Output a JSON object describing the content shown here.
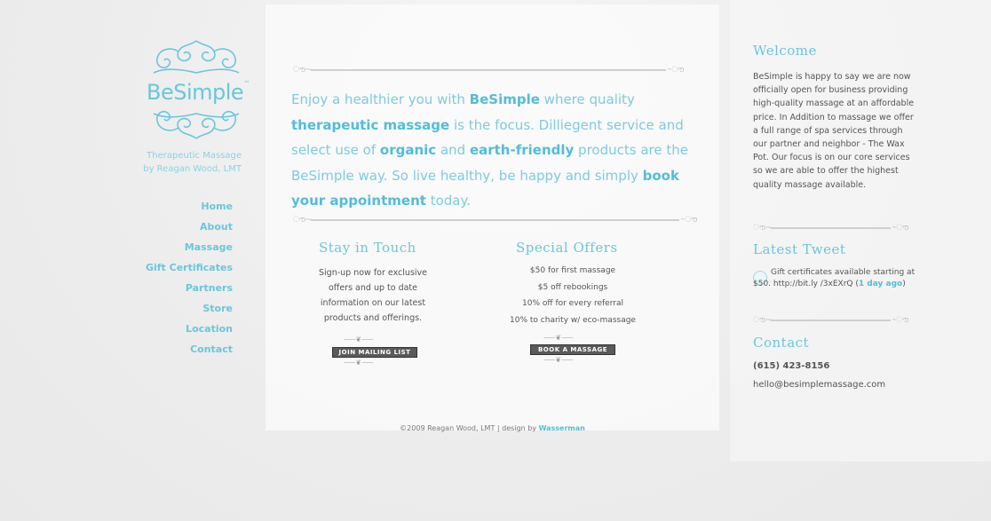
{
  "brand": {
    "name": "BeSimple",
    "tm": "™",
    "tagline_line1": "Therapeutic Massage",
    "tagline_line2": "by Reagan Wood, LMT"
  },
  "nav": [
    "Home",
    "About",
    "Massage",
    "Gift Certificates",
    "Partners",
    "Store",
    "Location",
    "Contact"
  ],
  "intro": {
    "p1": "Enjoy a healthier you with ",
    "b1": "BeSimple",
    "p2": " where quality ",
    "b2": "therapeutic massage",
    "p3": " is the focus. Dilliegent service and select use of ",
    "b3": "organic",
    "p4": " and ",
    "b4": "earth-friendly",
    "p5": " products are the BeSimple way. So live healthy, be happy and simply ",
    "b5": "book your appointment",
    "p6": " today."
  },
  "stay_in_touch": {
    "title": "Stay in Touch",
    "text": [
      "Sign-up now for exclusive",
      "offers and up to date",
      "information on our latest",
      "products and offerings."
    ],
    "button": "JOIN MAILING LIST"
  },
  "special_offers": {
    "title": "Special Offers",
    "items": [
      "$50 for first massage",
      "$5 off rebookings",
      "10% off for every referral",
      "10% to charity w/ eco-massage"
    ],
    "button": "BOOK A MASSAGE"
  },
  "footer": {
    "text": "©2009 Reagan Wood, LMT | design by ",
    "link": "Wasserman"
  },
  "welcome": {
    "title": "Welcome",
    "body": "BeSimple is happy to say we are now officially open for business providing high-quality massage at an affordable price. In Addition to massage we offer a full range of spa services through our partner and neighbor - The Wax Pot. Our focus is on our core services so we are able to offer the highest quality massage available."
  },
  "latest_tweet": {
    "title": "Latest Tweet",
    "text": "Gift certificates available starting at $50. http://bit.ly /3xEXrQ (",
    "link": "1 day ago",
    "close": ")"
  },
  "contact": {
    "title": "Contact",
    "phone": "(615) 423-8156",
    "email": "hello@besimplemassage.com"
  },
  "colors": {
    "accent": "#6cc5dc",
    "accent_dark": "#55bcd7",
    "text": "#555555",
    "background": "#efefef"
  }
}
